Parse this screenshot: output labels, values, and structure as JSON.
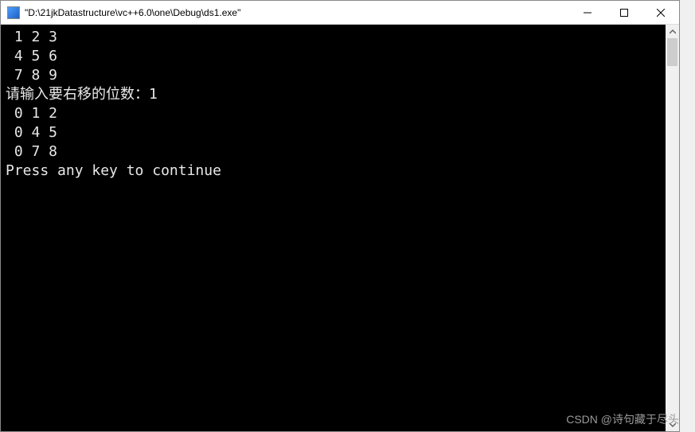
{
  "window": {
    "title": "\"D:\\21jkDatastructure\\vc++6.0\\one\\Debug\\ds1.exe\""
  },
  "console": {
    "lines": [
      " 1 2 3",
      " 4 5 6",
      " 7 8 9",
      "请输入要右移的位数：1",
      " 0 1 2",
      " 0 4 5",
      " 0 7 8",
      "Press any key to continue"
    ]
  },
  "watermark": "CSDN @诗句藏于尽头"
}
